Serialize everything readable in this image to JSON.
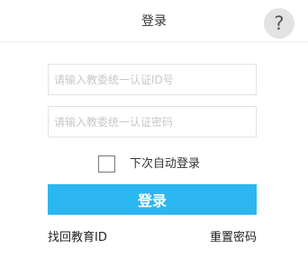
{
  "header": {
    "title": "登录",
    "help_label": "?",
    "help_icon": "question-mark-icon"
  },
  "form": {
    "id_field": {
      "placeholder": "请输入教委统一认证ID号",
      "value": ""
    },
    "password_field": {
      "placeholder": "请输入教委统一认证密码",
      "value": ""
    },
    "remember_checked": false,
    "remember_label": "下次自动登录",
    "login_label": "登录"
  },
  "links": {
    "find_id": "找回教育ID",
    "reset_password": "重置密码"
  },
  "colors": {
    "accent": "#2cb6f0",
    "help_bg": "#e3e3e3"
  }
}
